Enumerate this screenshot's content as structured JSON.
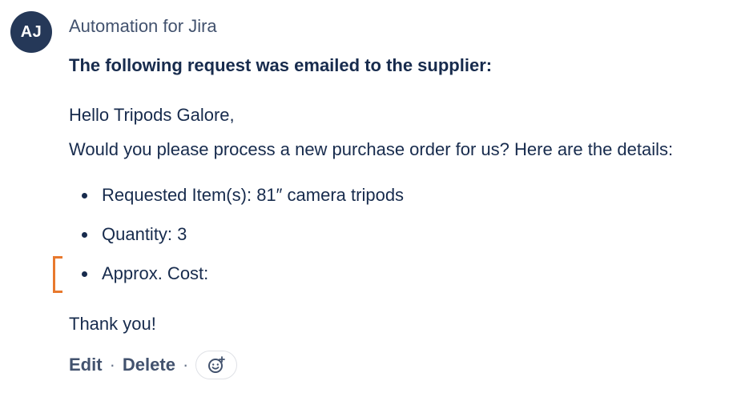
{
  "author": {
    "initials": "AJ",
    "name": "Automation for Jira"
  },
  "comment": {
    "heading": "The following request was emailed to the supplier:",
    "greeting": "Hello Tripods Galore,",
    "intro": "Would you please process a new purchase order for us? Here are the details:",
    "items": [
      {
        "label": "Requested Item(s): 81″ camera tripods"
      },
      {
        "label": "Quantity: 3"
      },
      {
        "label": "Approx. Cost:"
      }
    ],
    "closing": "Thank you!"
  },
  "actions": {
    "edit_label": "Edit",
    "delete_label": "Delete",
    "separator": "·",
    "reaction_icon": "smiley-add-icon"
  },
  "colors": {
    "avatar_bg": "#253858",
    "text": "#172b4d",
    "muted_text": "#42526e",
    "highlight_bracket": "#e8792d"
  }
}
